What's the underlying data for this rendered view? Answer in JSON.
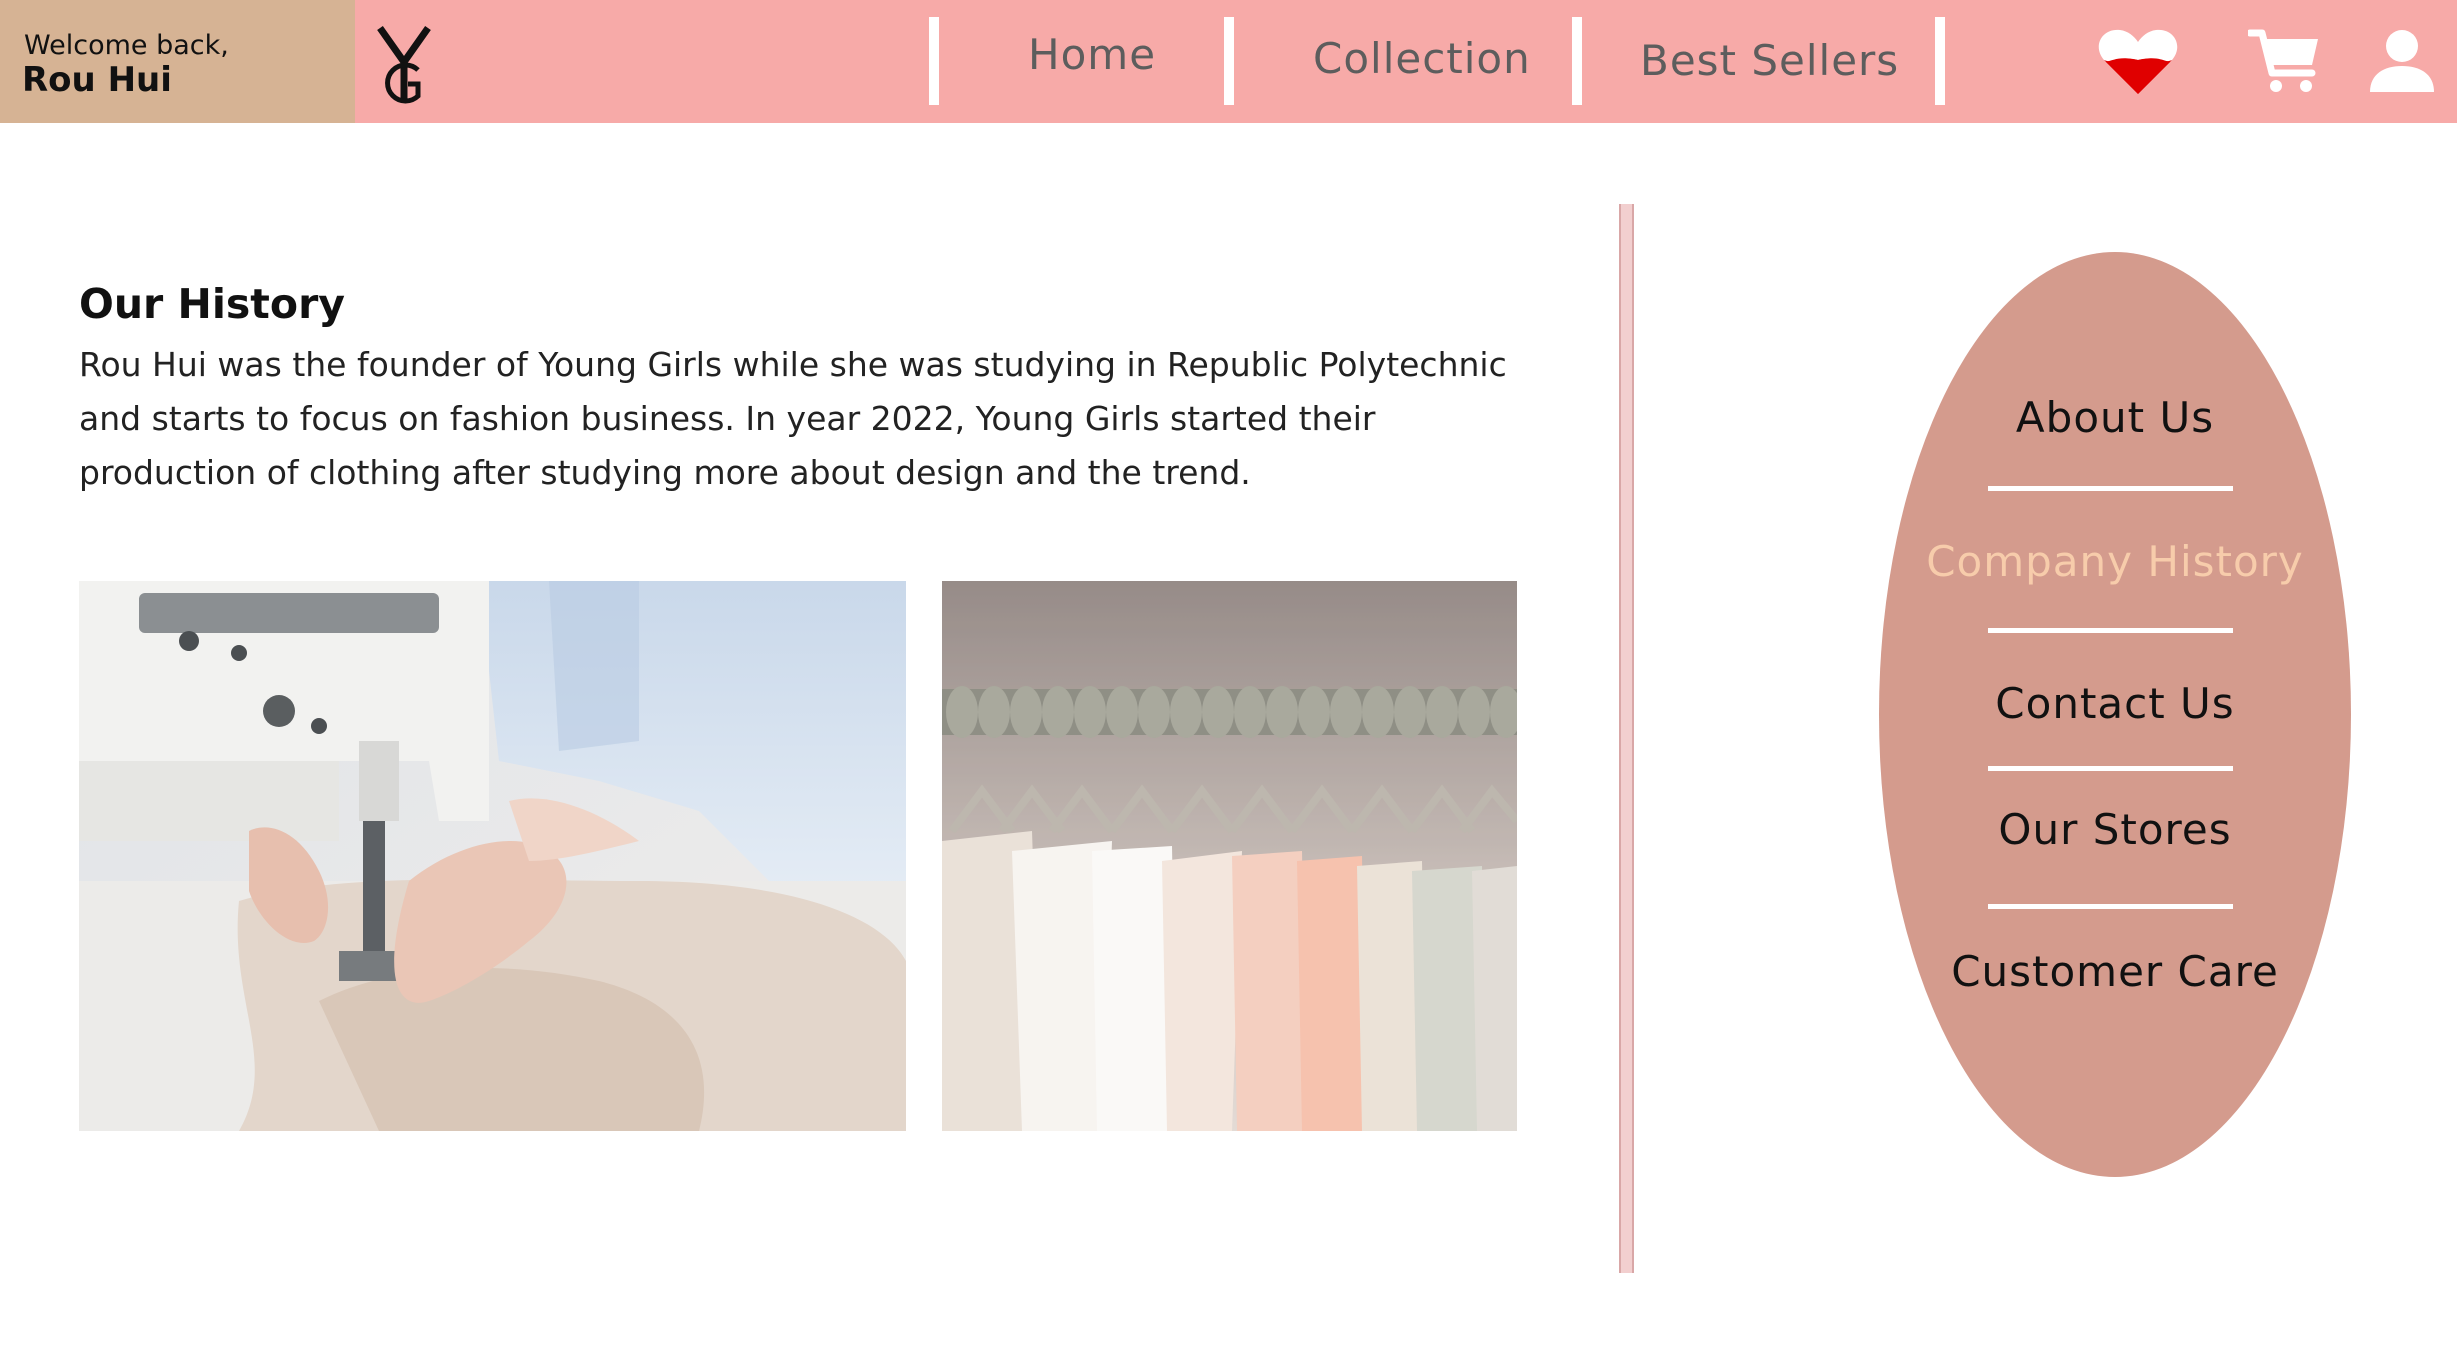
{
  "header": {
    "welcome_line": "Welcome back,",
    "user_name": "Rou Hui",
    "logo_icon": "yg-monogram-logo",
    "nav": [
      {
        "label": "Home"
      },
      {
        "label": "Collection"
      },
      {
        "label": "Best Sellers"
      }
    ],
    "icons": [
      "heart-icon",
      "cart-icon",
      "user-icon"
    ]
  },
  "main": {
    "heading": "Our History",
    "paragraph_lines": [
      "Rou Hui was the founder of Young Girls while she was studying in Republic Polytechnic",
      "and starts to focus on fashion business. In year 2022, Young Girls started their",
      "production of clothing after studying more about design and the trend."
    ],
    "images": [
      "sewing-machine-photo",
      "clothing-rack-photo"
    ]
  },
  "side_menu": {
    "items": [
      {
        "label": "About Us",
        "active": false
      },
      {
        "label": "Company History",
        "active": true
      },
      {
        "label": "Contact Us",
        "active": false
      },
      {
        "label": "Our Stores",
        "active": false
      },
      {
        "label": "Customer Care",
        "active": false
      }
    ]
  },
  "colors": {
    "header_bg": "#f7aaa8",
    "welcome_bg": "#d6b394",
    "menu_bg": "#d49b8d",
    "active_item": "#f7ccab",
    "heart_red": "#e00000"
  }
}
